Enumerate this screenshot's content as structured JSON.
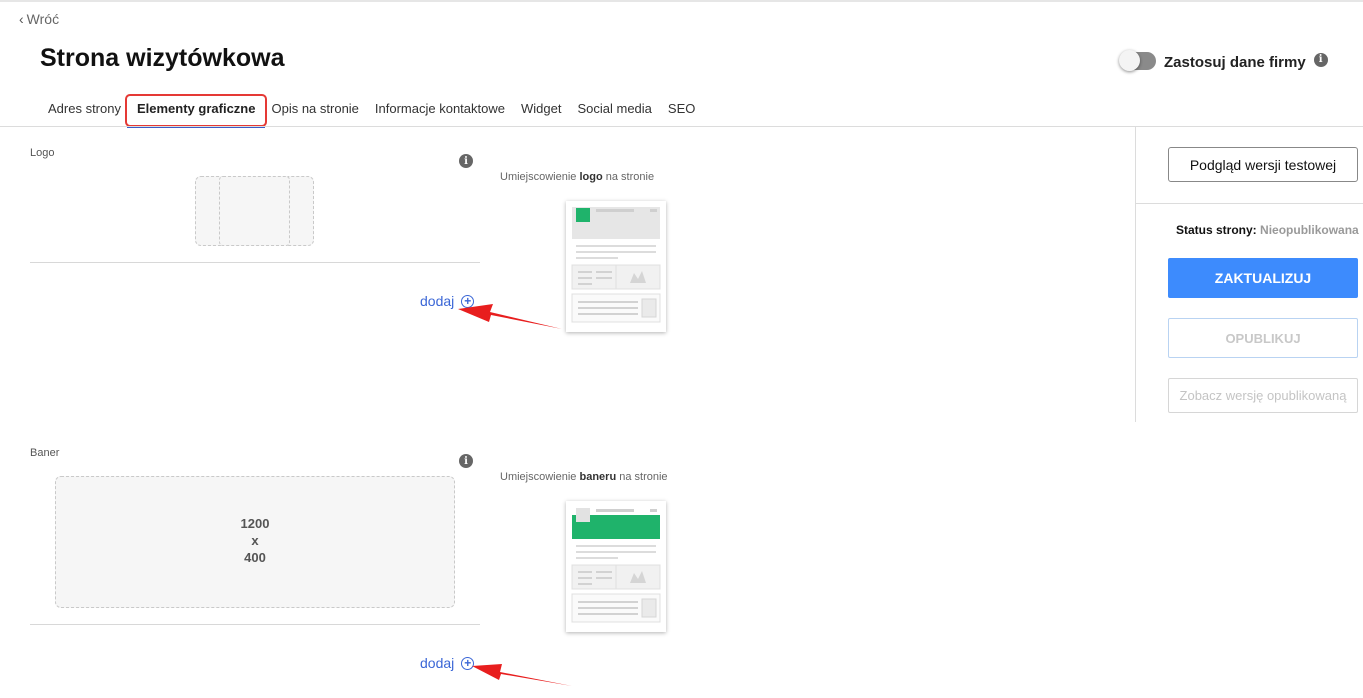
{
  "nav": {
    "back_label": "Wróć"
  },
  "header": {
    "title": "Strona wizytówkowa",
    "toggle_label": "Zastosuj dane firmy",
    "toggle_on": false
  },
  "tabs": [
    {
      "label": "Adres strony",
      "active": false
    },
    {
      "label": "Elementy graficzne",
      "active": true
    },
    {
      "label": "Opis na stronie",
      "active": false
    },
    {
      "label": "Informacje kontaktowe",
      "active": false
    },
    {
      "label": "Widget",
      "active": false
    },
    {
      "label": "Social media",
      "active": false
    },
    {
      "label": "SEO",
      "active": false
    }
  ],
  "logo_section": {
    "label": "Logo",
    "placement_prefix": "Umiejscowienie",
    "placement_bold": "logo",
    "placement_suffix": "na stronie",
    "add_label": "dodaj"
  },
  "banner_section": {
    "label": "Baner",
    "size_w": "1200",
    "size_x": "x",
    "size_h": "400",
    "placement_prefix": "Umiejscowienie",
    "placement_bold": "baneru",
    "placement_suffix": "na stronie",
    "add_label": "dodaj"
  },
  "sidebar": {
    "preview_button": "Podgląd wersji testowej",
    "status_label": "Status strony:",
    "status_value": "Nieopublikowana",
    "update_button": "ZAKTUALIZUJ",
    "publish_button": "OPUBLIKUJ",
    "view_published_button": "Zobacz wersję opublikowaną"
  },
  "colors": {
    "accent_blue": "#3d8bfd",
    "link_blue": "#3a66d6",
    "highlight_red": "#e53935",
    "preview_green": "#1fb36b"
  }
}
